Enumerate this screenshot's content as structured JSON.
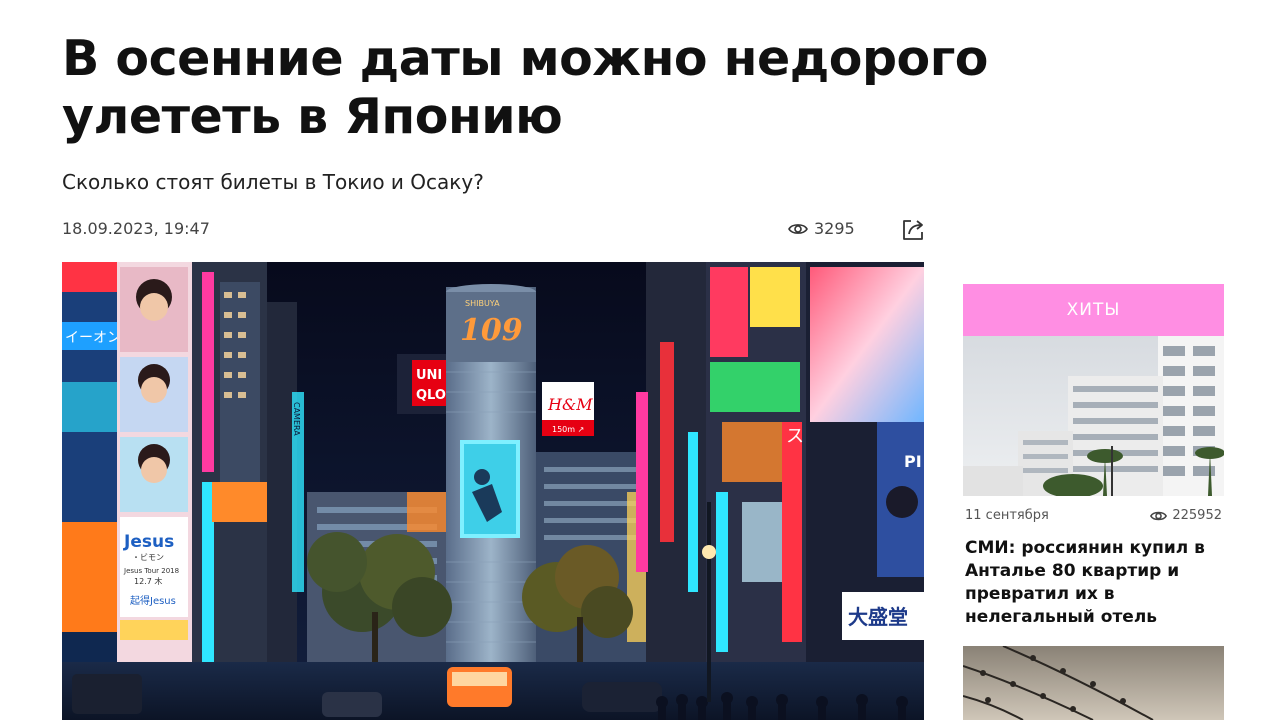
{
  "article": {
    "title": "В осенние даты можно недорого улететь в Японию",
    "subtitle": "Сколько стоят билеты в Токио и Осаку?",
    "date": "18.09.2023, 19:47",
    "views": "3295",
    "share_icon": "share-icon",
    "views_icon": "eye-icon"
  },
  "hero_image": {
    "signs": {
      "tower": "SHIBUYA",
      "tower_number": "109",
      "uniqlo_line1": "UNI",
      "uniqlo_line2": "QLO",
      "hm": "H&M",
      "hm_sub": "150m ↗",
      "left_banner": "イーオン",
      "jesus": "Jesus",
      "jesus_sub1": "・ビモン",
      "jesus_sub2": "Jesus Tour 2018",
      "jesus_sub3": "12.7 木",
      "jesus_sub4": "起得Jesus",
      "camera": "CAMERA",
      "daiseido": "大盛堂",
      "kanji_right": "ス",
      "pi": "PI"
    },
    "colors": {
      "sky": "#0a0d24",
      "neon_pink": "#ff3aa0",
      "neon_cyan": "#2fe6ff",
      "neon_orange": "#ff8a2a",
      "uniqlo_red": "#e60012"
    }
  },
  "sidebar": {
    "header": "ХИТЫ",
    "cards": [
      {
        "date": "11 сентября",
        "views": "225952",
        "title": "СМИ: россиянин купил в Анталье 80 квартир и превратил их в нелегальный отель"
      }
    ],
    "accent_color": "#ff8ee3"
  }
}
